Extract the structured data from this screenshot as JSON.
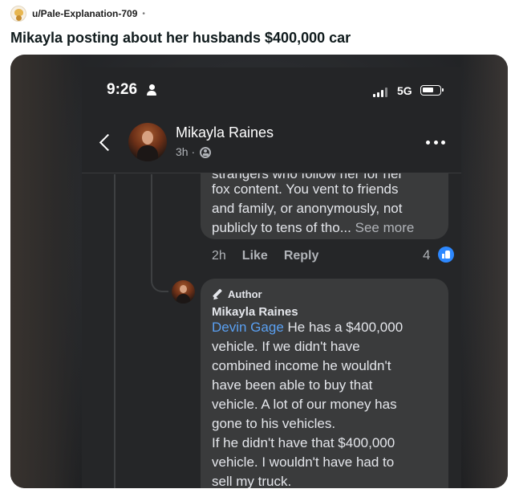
{
  "post": {
    "username": "u/Pale-Explanation-709",
    "separator": "•",
    "title": "Mikayla posting about her husbands $400,000 car"
  },
  "phone": {
    "status": {
      "time": "9:26",
      "network": "5G"
    },
    "nav": {
      "name": "Mikayla Raines",
      "time": "3h ·"
    },
    "comment1": {
      "cut_line": "strangers who follow her for her",
      "lines": [
        "fox content. You vent to friends",
        "and family, or anonymously, not",
        "publicly to tens of tho..."
      ],
      "see_more": "See more",
      "time": "2h",
      "like": "Like",
      "reply": "Reply",
      "like_count": "4"
    },
    "comment2": {
      "badge": "Author",
      "name": "Mikayla Raines",
      "mention": "Devin Gage",
      "first_line_rest": " He has a $400,000",
      "lines": [
        "vehicle. If we didn't have",
        "combined income he wouldn't",
        "have been able to buy that",
        "vehicle. A lot of our money has",
        "gone to his vehicles.",
        "If he didn't have that $400,000",
        "vehicle. I wouldn't have had to",
        "sell my truck."
      ]
    }
  },
  "colors": {
    "background": "#252628",
    "bubble": "#3a3b3c",
    "text": "#e4e6eb",
    "secondary_text": "#b0b3b8",
    "mention": "#5aa0f2",
    "like_blue": "#2d88ff"
  },
  "icons": [
    "person-icon",
    "signal-icon",
    "battery-icon",
    "back-icon",
    "globe-icon",
    "more-icon",
    "like-icon",
    "pen-icon"
  ]
}
